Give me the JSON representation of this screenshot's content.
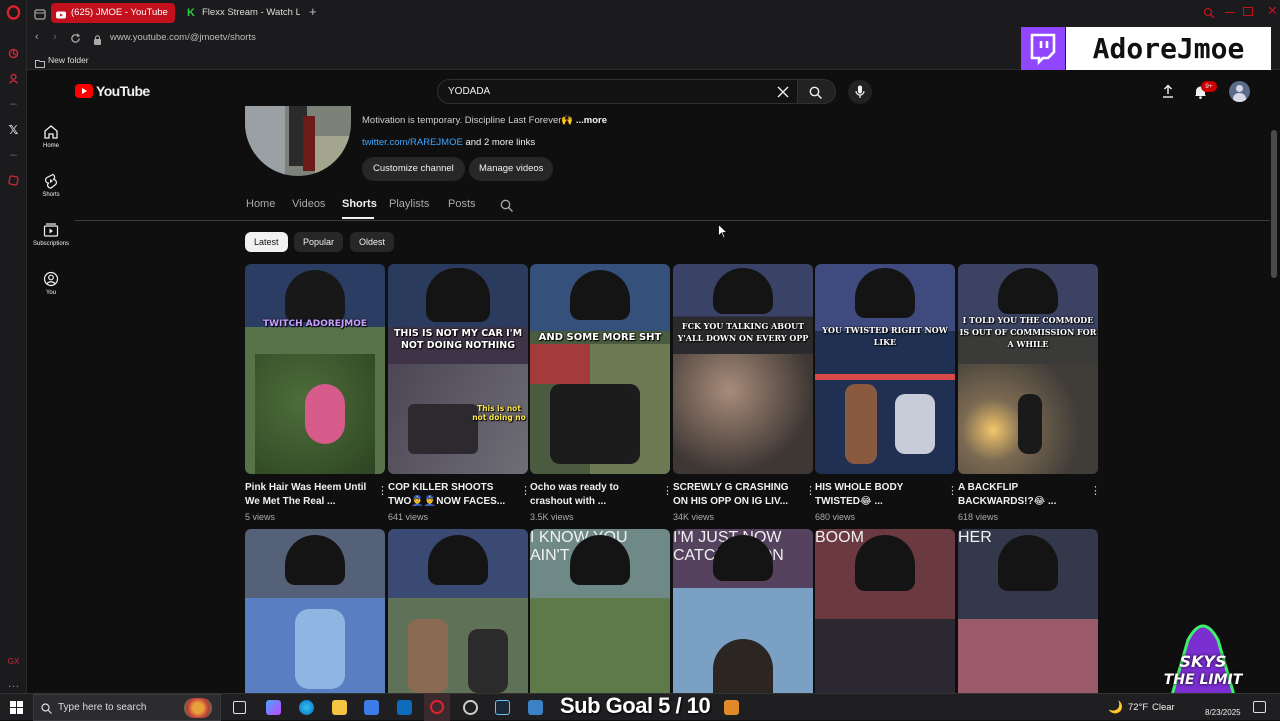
{
  "browser": {
    "tabs": [
      {
        "title": "(625) JMOE - YouTube",
        "active": true
      },
      {
        "title": "Flexx Stream - Watch Live"
      }
    ],
    "url": "www.youtube.com/@jmoetv/shorts",
    "bookmark": "New folder"
  },
  "overlay": {
    "twitch_name": "AdoreJmoe",
    "sub_goal": "Sub Goal 5 / 10",
    "badge_line1": "SKYS",
    "badge_line2": "THE LIMIT"
  },
  "youtube": {
    "logo": "YouTube",
    "search_value": "YODADA",
    "notification_count": "9+",
    "nav": [
      {
        "label": "Home",
        "icon": "home-icon"
      },
      {
        "label": "Shorts",
        "icon": "shorts-icon"
      },
      {
        "label": "Subscriptions",
        "icon": "subscriptions-icon"
      },
      {
        "label": "You",
        "icon": "you-icon"
      }
    ],
    "channel": {
      "description": "Motivation is temporary. Discipline Last Forever🙌",
      "more_label": "...more",
      "link": "twitter.com/RAREJMOE",
      "more_links": "and 2 more links",
      "customize_label": "Customize channel",
      "manage_label": "Manage videos"
    },
    "channel_tabs": [
      "Home",
      "Videos",
      "Shorts",
      "Playlists",
      "Posts"
    ],
    "active_tab": "Shorts",
    "chips": [
      "Latest",
      "Popular",
      "Oldest"
    ],
    "shorts": [
      {
        "title": "Pink Hair Was Heem Until We Met The Real ...",
        "views": "5 views",
        "caption": "TWITCH ADOREJMOE"
      },
      {
        "title": "COP KILLER SHOOTS TWO👮‍♂️👮‍♂️NOW FACES...",
        "views": "641 views",
        "caption": "THIS IS NOT MY CAR I'M NOT DOING NOTHING",
        "caption2": "This is not not doing no"
      },
      {
        "title": "Ocho was ready to crashout with ...",
        "views": "3.5K views",
        "caption": "AND SOME MORE SHT"
      },
      {
        "title": "SCREWLY G CRASHING ON HIS OPP ON IG LIV...",
        "views": "34K views",
        "caption": "FCK YOU TALKING ABOUT Y'ALL DOWN ON EVERY OPP"
      },
      {
        "title": "HIS WHOLE BODY TWISTED😂 ...",
        "views": "680 views",
        "caption": "YOU TWISTED RIGHT NOW LIKE"
      },
      {
        "title": "A BACKFLIP BACKWARDS!?😂 ...",
        "views": "618 views",
        "caption": "I TOLD YOU THE COMMODE IS OUT OF COMMISSION FOR A WHILE"
      }
    ],
    "shorts_row2_captions": [
      "",
      "",
      "I KNOW YOU AIN'T",
      "I'M JUST NOW CATCHING ON",
      "BOOM",
      "HER"
    ]
  },
  "taskbar": {
    "search_placeholder": "Type here to search",
    "weather": "72°F",
    "weather_desc": "Clear",
    "date": "8/23/2025"
  }
}
